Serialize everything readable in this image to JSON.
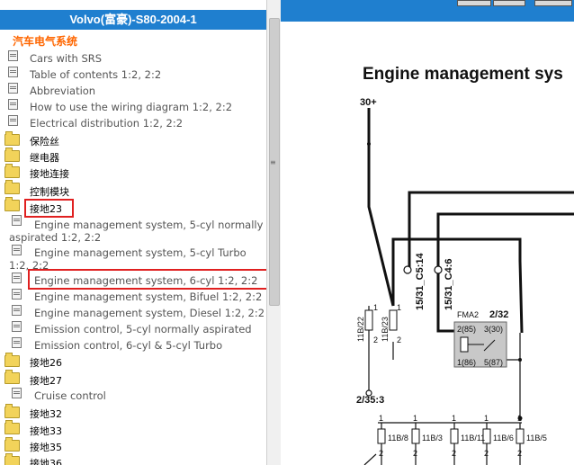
{
  "tree": {
    "title": "Volvo(富豪)-S80-2004-1",
    "section": "汽车电气系统",
    "items": [
      {
        "label": "Cars with SRS"
      },
      {
        "label": "Table of contents 1:2, 2:2"
      },
      {
        "label": "Abbreviation"
      },
      {
        "label": "How to use the wiring diagram 1:2, 2:2"
      },
      {
        "label": "Electrical distribution 1:2, 2:2"
      },
      {
        "label": "保险丝"
      },
      {
        "label": "继电器"
      },
      {
        "label": "接地连接"
      },
      {
        "label": "控制模块"
      },
      {
        "label": "接地23"
      },
      {
        "label_line1": "Engine management system, 5-cyl normally",
        "label_line2": "aspirated 1:2, 2:2"
      },
      {
        "label_line1": "Engine management system, 5-cyl Turbo",
        "label_line2": "1:2, 2:2"
      },
      {
        "label": "Engine management system, 6-cyl 1:2, 2:2"
      },
      {
        "label": "Engine management system, Bifuel 1:2, 2:2"
      },
      {
        "label": "Engine management system, Diesel 1:2, 2:2"
      },
      {
        "label": "Emission control, 5-cyl normally aspirated"
      },
      {
        "label": "Emission control, 6-cyl & 5-cyl Turbo"
      },
      {
        "label": "接地26"
      },
      {
        "label": "接地27"
      },
      {
        "label": "Cruise control"
      },
      {
        "label": "接地32"
      },
      {
        "label": "接地33"
      },
      {
        "label": "接地35"
      },
      {
        "label": "接地36"
      }
    ]
  },
  "diagram": {
    "title": "Engine management sys",
    "labels": {
      "supply": "30+",
      "ground": "2/35:3",
      "conn1": "15/31_C5:14",
      "conn2": "15/31_C4:6",
      "fuse_a": "11B/22",
      "fuse_b": "11B/23",
      "relay_name": "FMA2",
      "relay_ref": "2/32",
      "pin_2": "2(85)",
      "pin_3": "3(30)",
      "pin_1": "1(86)",
      "pin_5": "5(87)",
      "f1": "11B/8",
      "f2": "11B/3",
      "f3": "11B/11",
      "f4": "11B/6",
      "f5": "11B/5",
      "num1": "1",
      "num2": "2"
    }
  },
  "colors": {
    "title_bar": "#1f7fcf",
    "section": "#ff6600",
    "highlight": "#e02020"
  }
}
